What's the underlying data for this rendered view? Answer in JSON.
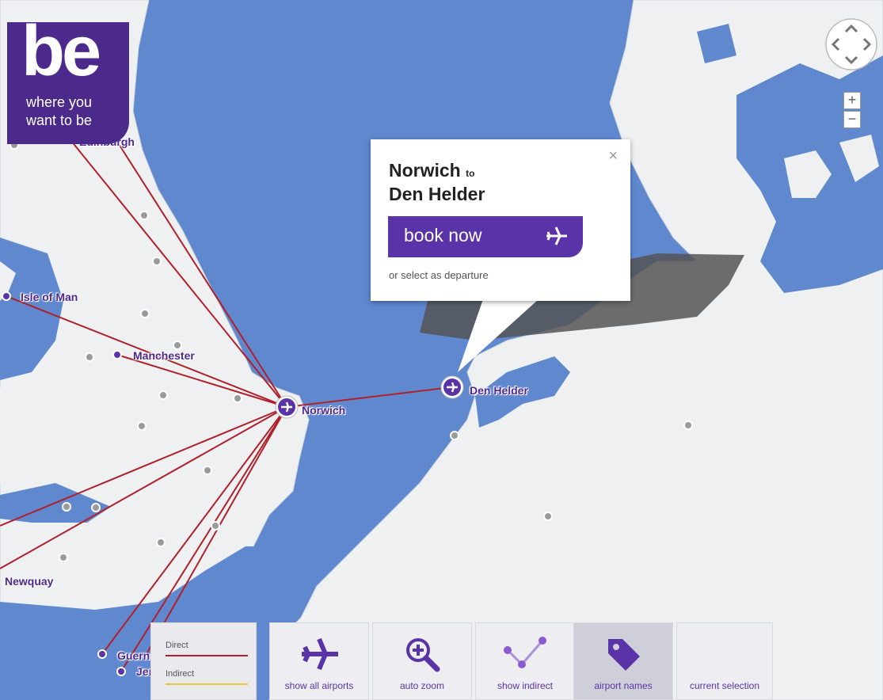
{
  "logo": {
    "mark": "be",
    "tagline_line1": "where you",
    "tagline_line2": "want to be"
  },
  "airports": [
    {
      "name": "Edinburgh",
      "display": "Edinburgh"
    },
    {
      "name": "Isle of Man",
      "display": "Isle of Man"
    },
    {
      "name": "Manchester",
      "display": "Manchester"
    },
    {
      "name": "Norwich",
      "display": "Norwich"
    },
    {
      "name": "Den Helder",
      "display": "Den Helder"
    },
    {
      "name": "Newquay",
      "display": "Newquay"
    },
    {
      "name": "Guernsey",
      "display": "Guernsey"
    },
    {
      "name": "Jersey",
      "display": "Jersey"
    }
  ],
  "popup": {
    "close": "×",
    "origin": "Norwich",
    "connector": "to",
    "destination": "Den Helder",
    "book_label": "book now",
    "departure_link": "or select as departure"
  },
  "legend": {
    "direct": "Direct",
    "indirect": "Indirect"
  },
  "toolbar": [
    {
      "id": "show-all-airports",
      "label": "show all airports",
      "icon": "plane-icon"
    },
    {
      "id": "auto-zoom",
      "label": "auto zoom",
      "icon": "magnifier-plus-icon"
    },
    {
      "id": "show-indirect",
      "label": "show indirect",
      "icon": "indirect-route-icon"
    },
    {
      "id": "airport-names",
      "label": "airport names",
      "icon": "tag-icon",
      "active": true
    },
    {
      "id": "current-selection",
      "label": "current selection",
      "icon": ""
    }
  ],
  "zoom": {
    "in": "+",
    "out": "−"
  },
  "colors": {
    "brand": "#4b2a8c",
    "route": "#b0202a",
    "sea": "#5f88cf",
    "land": "#eef0f2",
    "label": "#4b2796"
  }
}
